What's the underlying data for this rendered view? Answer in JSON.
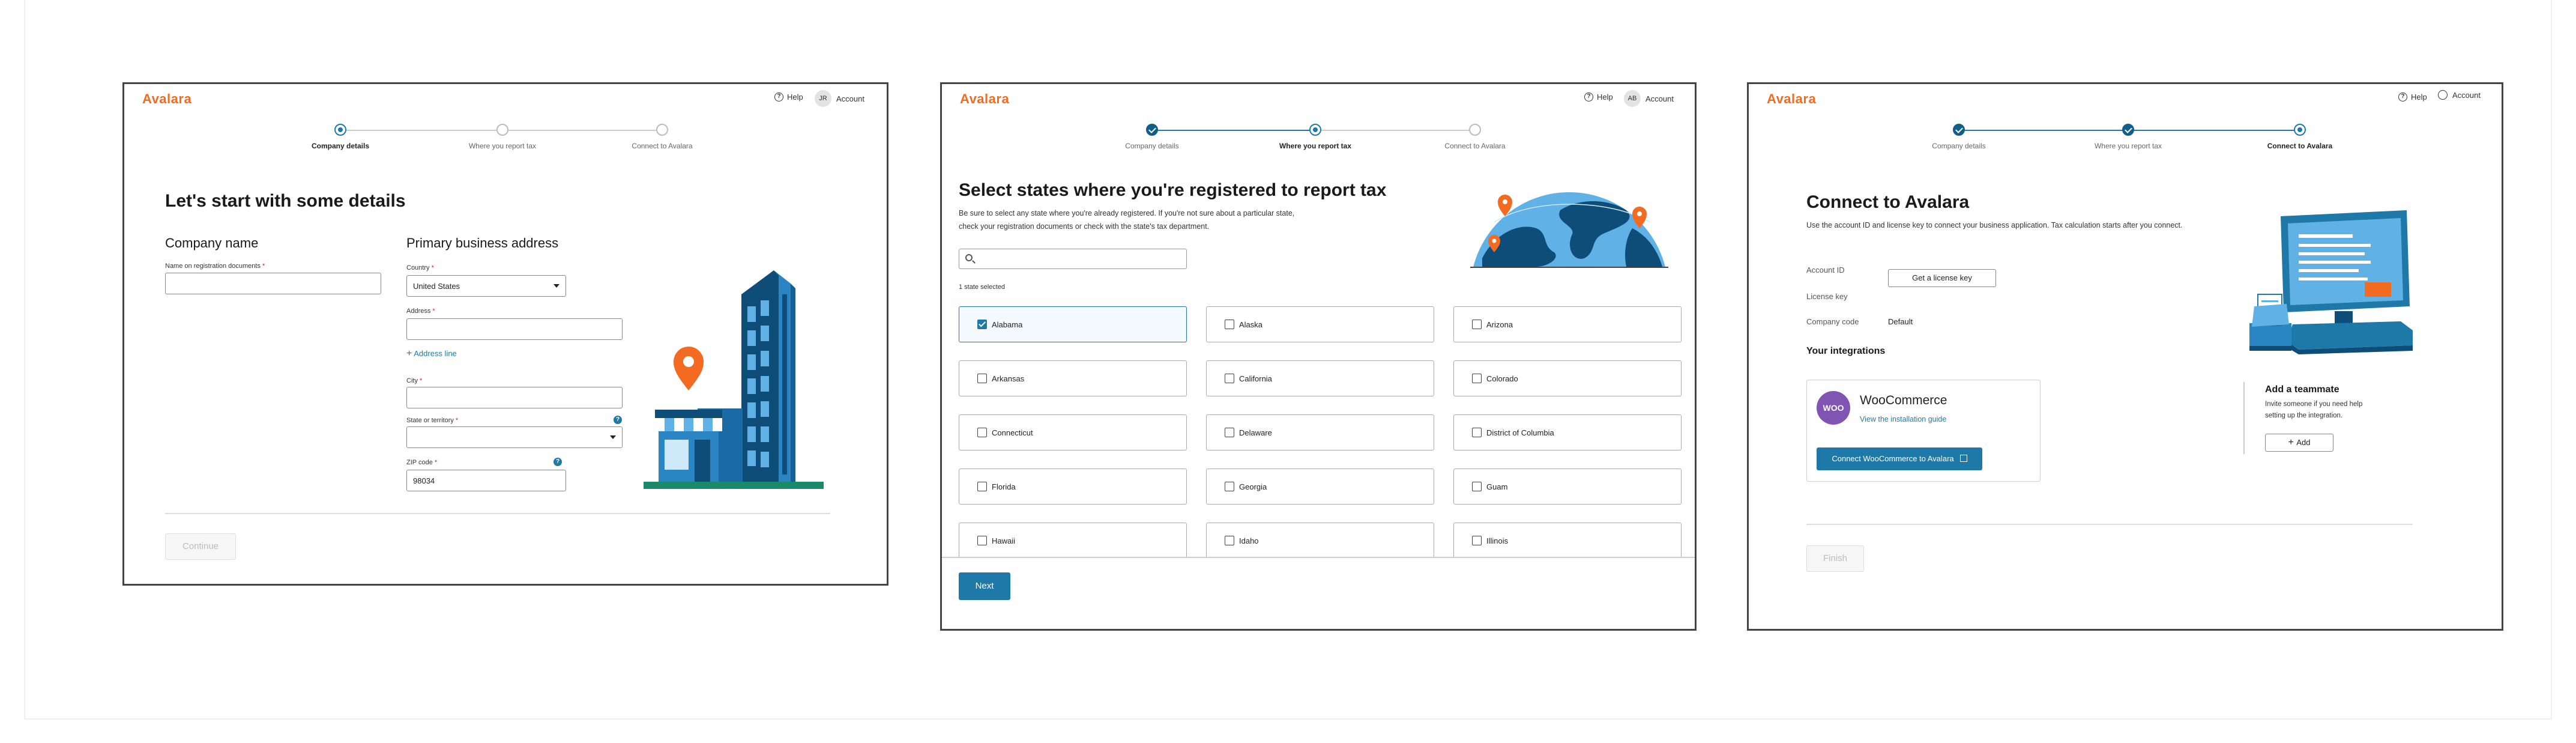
{
  "brand": {
    "logo": "Avalara",
    "accent": "#1f79a8",
    "logo_color": "#f26b21"
  },
  "header": {
    "help": "Help",
    "account": "Account"
  },
  "screens": [
    {
      "avatar": "JR",
      "steps": [
        "Company details",
        "Where you report tax",
        "Connect to Avalara"
      ],
      "title": "Let's start with some details",
      "company_section": "Company name",
      "name_label": "Name on registration documents",
      "name_value": "",
      "address_section": "Primary business address",
      "country_label": "Country",
      "country_value": "United States",
      "address_label": "Address",
      "add_address_line": "Address line",
      "city_label": "City",
      "state_label": "State or territory",
      "zip_label": "ZIP code",
      "zip_value": "98034",
      "continue": "Continue"
    },
    {
      "avatar": "AB",
      "steps": [
        "Company details",
        "Where you report tax",
        "Connect to Avalara"
      ],
      "title": "Select states where you're registered to report tax",
      "desc_1": "Be sure to select any state where you're already registered. If you're not sure about a particular state,",
      "desc_2": "check your registration documents or check with the state's tax department.",
      "search_placeholder": "",
      "selected_count": "1 state selected",
      "states": [
        "Alabama",
        "Alaska",
        "Arizona",
        "Arkansas",
        "California",
        "Colorado",
        "Connecticut",
        "Delaware",
        "District of Columbia",
        "Florida",
        "Georgia",
        "Guam",
        "Hawaii",
        "Idaho",
        "Illinois"
      ],
      "next": "Next"
    },
    {
      "avatar": "",
      "steps": [
        "Company details",
        "Where you report tax",
        "Connect to Avalara"
      ],
      "title": "Connect to Avalara",
      "desc": "Use the account ID and license key to connect your business application. Tax calculation starts after you connect.",
      "account_id_label": "Account ID",
      "get_license": "Get a license key",
      "license_label": "License key",
      "company_code_label": "Company code",
      "company_code_value": "Default",
      "integrations_title": "Your integrations",
      "woo_badge": "WOO",
      "woo_name": "WooCommerce",
      "woo_link": "View the installation guide",
      "woo_button": "Connect WooCommerce to Avalara",
      "teammate_title": "Add a teammate",
      "teammate_desc_1": "Invite someone if you need help",
      "teammate_desc_2": "setting up the integration.",
      "add_button": "Add",
      "finish": "Finish"
    }
  ]
}
